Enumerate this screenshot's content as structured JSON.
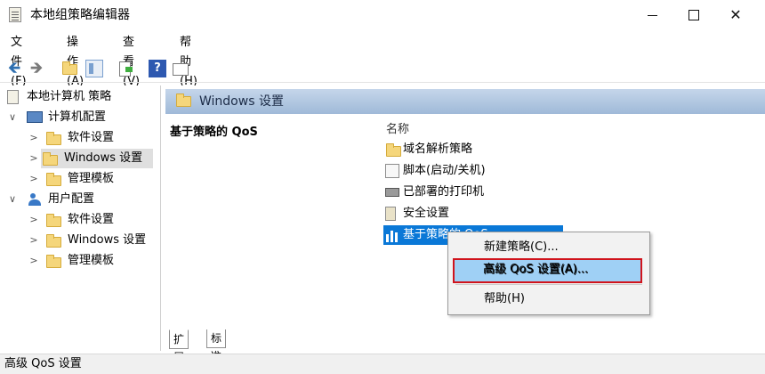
{
  "window": {
    "title": "本地组策略编辑器",
    "minimize_glyph": "",
    "maximize_glyph": "",
    "close_glyph": "✕"
  },
  "menu": [
    "文件(F)",
    "操作(A)",
    "查看(V)",
    "帮助(H)"
  ],
  "toolbar": {
    "back_glyph": "🡸",
    "forward_glyph": "🡺",
    "help_glyph": "?"
  },
  "tree": {
    "root": "本地计算机 策略",
    "computer_config": "计算机配置",
    "computer_children": [
      "软件设置",
      "Windows 设置",
      "管理模板"
    ],
    "user_config": "用户配置",
    "user_children": [
      "软件设置",
      "Windows 设置",
      "管理模板"
    ],
    "expanded_glyph": "∨",
    "collapsed_glyph": ">"
  },
  "content": {
    "header_title": "Windows 设置",
    "description_title": "基于策略的 QoS",
    "column_name": "名称",
    "items": [
      "域名解析策略",
      "脚本(启动/关机)",
      "已部署的打印机",
      "安全设置",
      "基于策略的 QoS"
    ]
  },
  "tabs": [
    "扩展",
    "标准"
  ],
  "context_menu": {
    "items": [
      "新建策略(C)...",
      "高级 QoS 设置(A)...",
      "帮助(H)"
    ]
  },
  "status_bar": {
    "text": "高级 QoS 设置"
  },
  "colors": {
    "selection_blue": "#0a78d7",
    "highlight_border": "#d0131c",
    "header_gradient": "#9fb9d8"
  }
}
